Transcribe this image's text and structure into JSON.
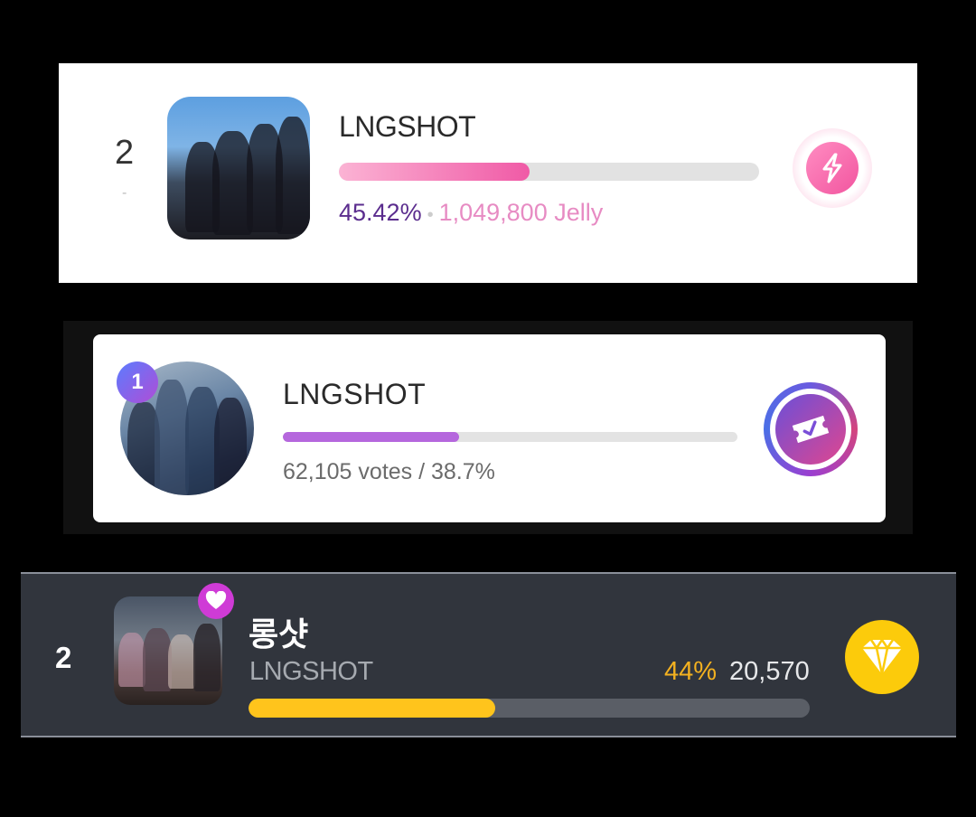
{
  "card1": {
    "rank": "2",
    "rank_change": "-",
    "name": "LNGSHOT",
    "progress_percent": 45.42,
    "percent_text": "45.42%",
    "separator": "•",
    "jelly_text": "1,049,800 Jelly",
    "action_icon": "lightning-bolt-icon"
  },
  "card2": {
    "rank_badge": "1",
    "name": "LNGSHOT",
    "progress_percent": 38.7,
    "stats_text": "62,105 votes / 38.7%",
    "action_icon": "vote-ticket-icon"
  },
  "card3": {
    "rank": "2",
    "title": "롱샷",
    "subtitle": "LNGSHOT",
    "percent_text": "44%",
    "count_text": "20,570",
    "progress_percent": 44,
    "badge_icon": "heart-icon",
    "action_icon": "diamond-gem-icon"
  },
  "colors": {
    "card1_accent": "#f05aa6",
    "card1_percent": "#5b2d8e",
    "card2_accent": "#b567dd",
    "card3_accent": "#ffc41c",
    "card3_percent": "#f3b120"
  }
}
